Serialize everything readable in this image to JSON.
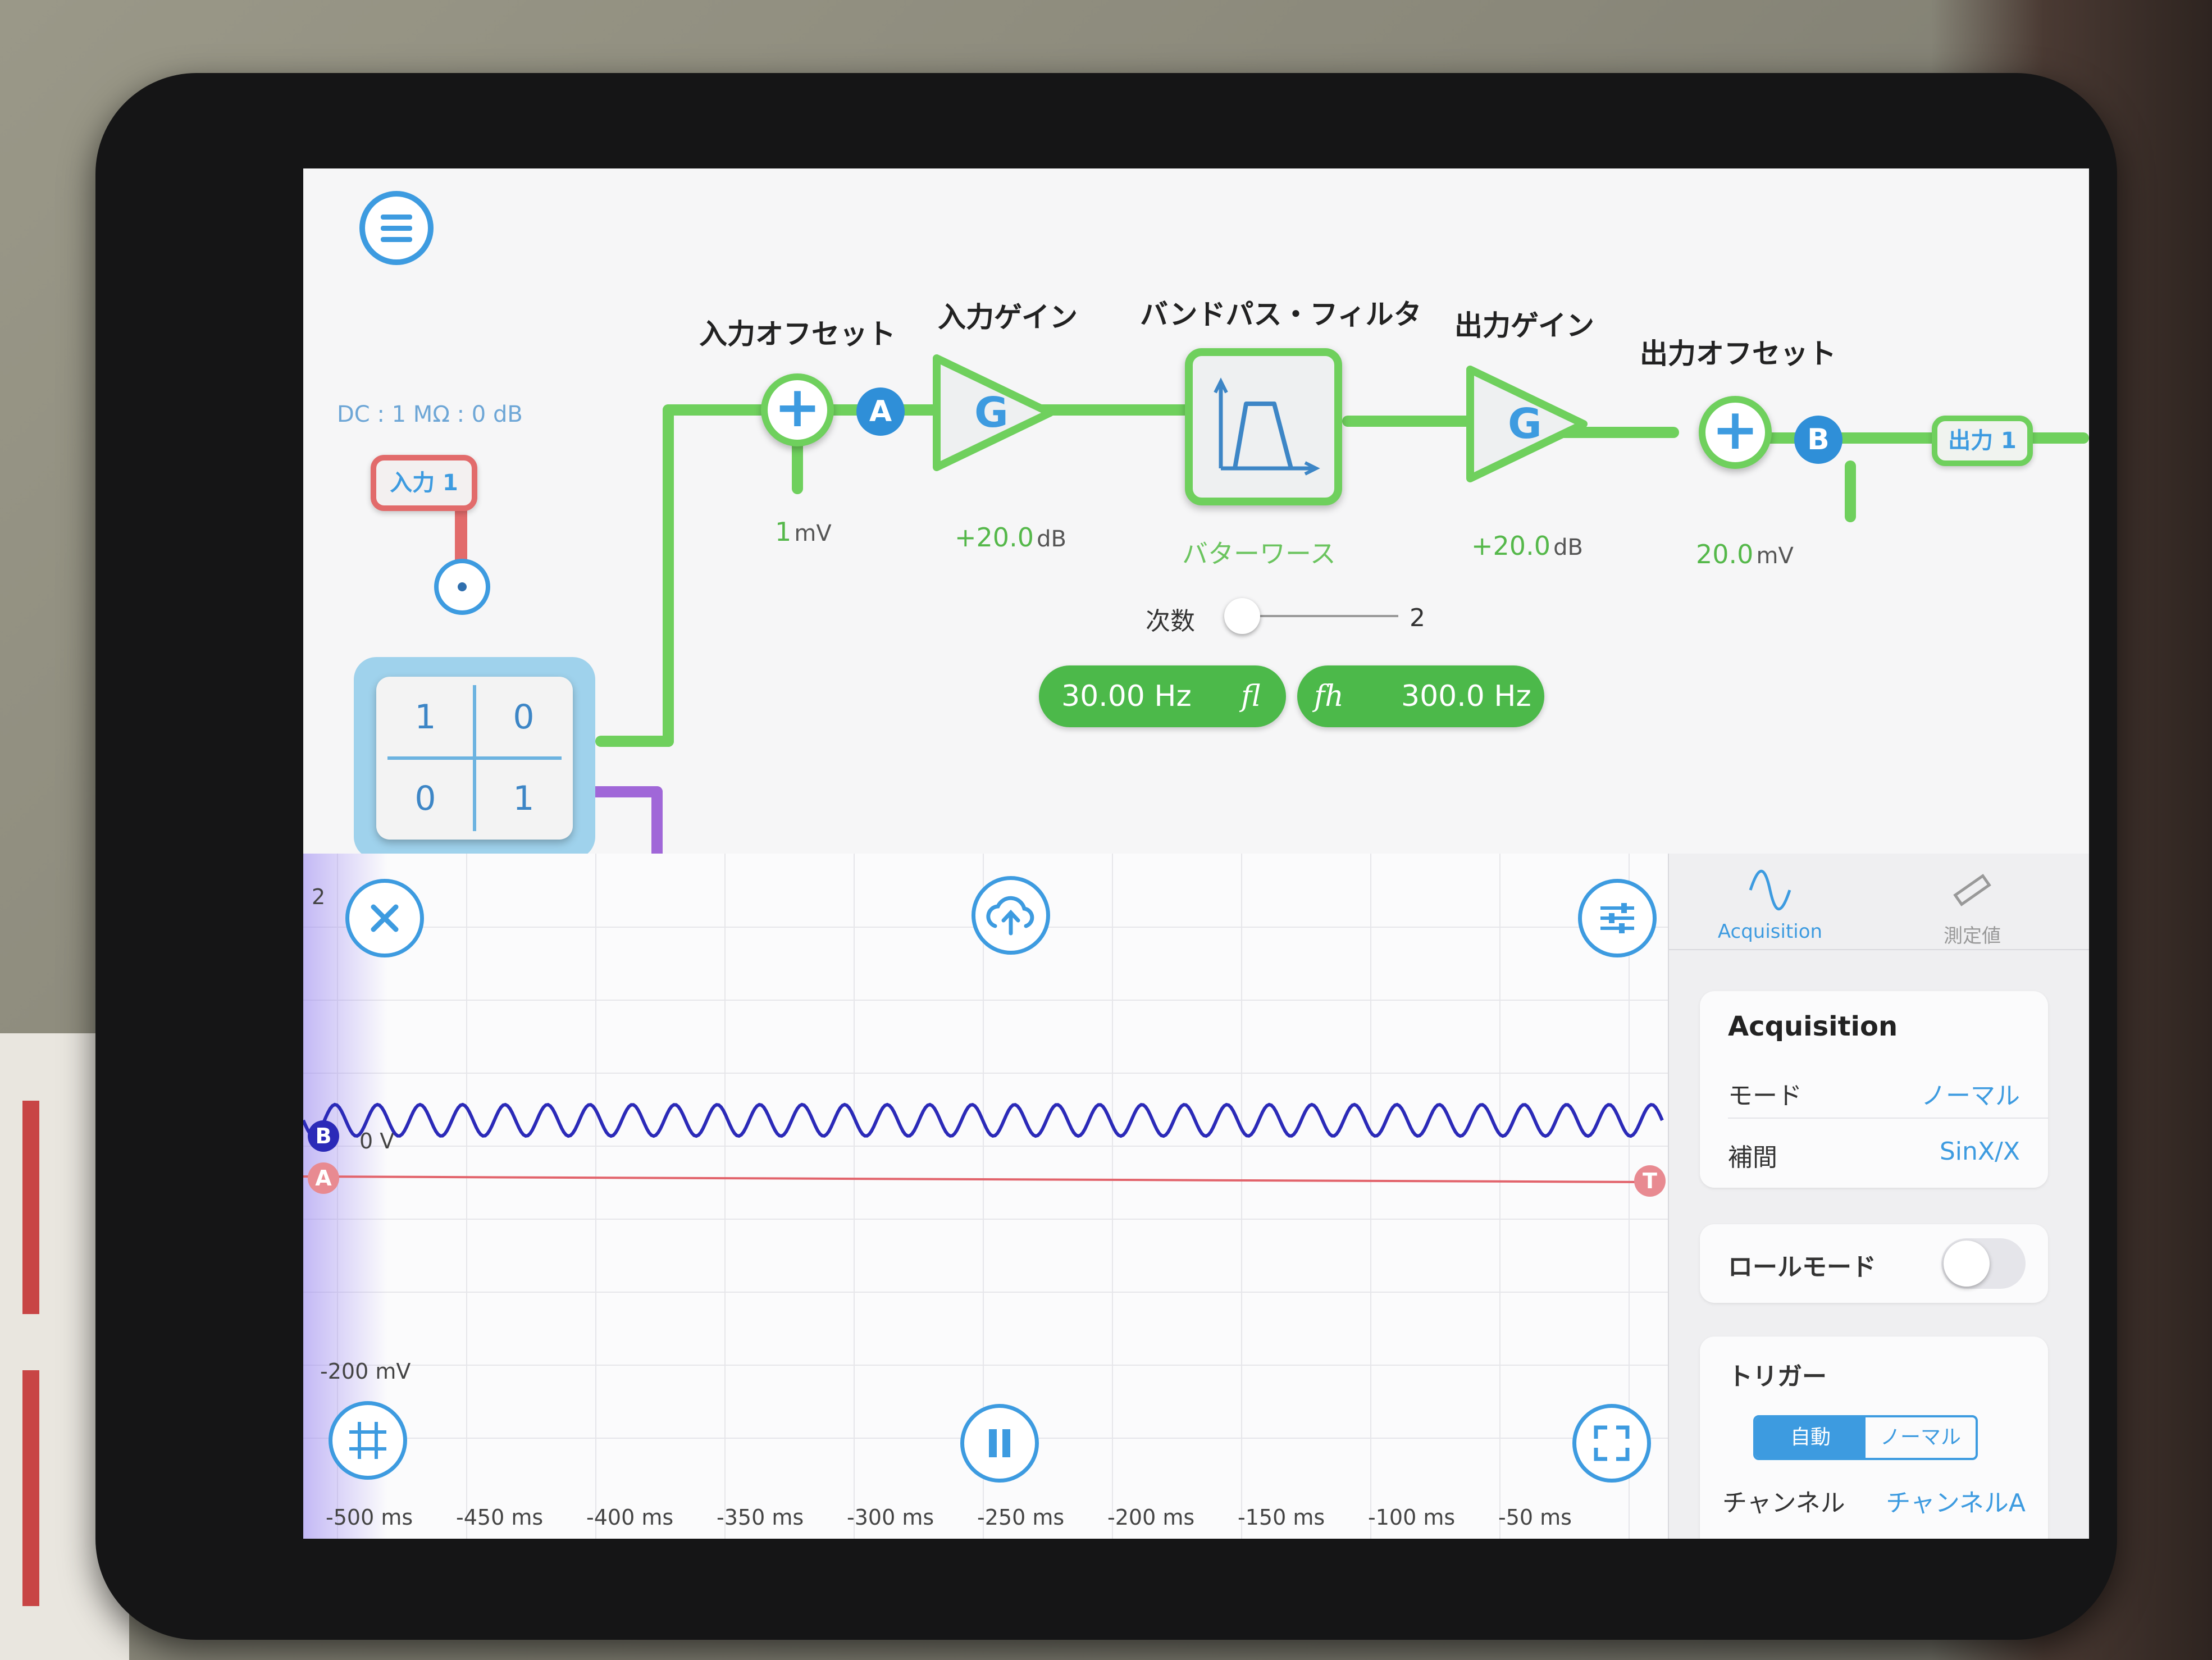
{
  "pipeline": {
    "input_label": "入力 1",
    "input_coupling": "DC : 1 MΩ : 0 dB",
    "matrix": [
      "1",
      "0",
      "0",
      "1"
    ],
    "input_offset": {
      "title": "入力オフセット",
      "value": "1",
      "unit": "mV"
    },
    "probe_a": "A",
    "input_gain": {
      "title": "入力ゲイン",
      "symbol": "G",
      "value": "+20.0",
      "unit": "dB"
    },
    "bandpass": {
      "title": "バンドパス・フィルタ",
      "type": "バターワース",
      "order_label": "次数",
      "order_value": "2"
    },
    "output_gain": {
      "title": "出力ゲイン",
      "symbol": "G",
      "value": "+20.0",
      "unit": "dB"
    },
    "output_offset": {
      "title": "出力オフセット",
      "value": "20.0",
      "unit": "mV"
    },
    "probe_b": "B",
    "output_label": "出力 1",
    "f_low": {
      "value": "30.00 Hz",
      "symbol": "fl"
    },
    "f_high": {
      "value": "300.0 Hz",
      "symbol": "fh"
    }
  },
  "scope": {
    "top_label": "2",
    "zero_label": "0 V",
    "bottom_label": "-200 mV",
    "channel_b": "B",
    "channel_a": "A",
    "trigger_marker": "T",
    "x_ticks": [
      "-500 ms",
      "-450 ms",
      "-400 ms",
      "-350 ms",
      "-300 ms",
      "-250 ms",
      "-200 ms",
      "-150 ms",
      "-100 ms",
      "-50 ms"
    ]
  },
  "side_panel": {
    "tabs": [
      "Acquisition",
      "測定値"
    ],
    "acquisition_title": "Acquisition",
    "mode_label": "モード",
    "mode_value": "ノーマル",
    "interp_label": "補間",
    "interp_value": "SinX/X",
    "roll_mode_label": "ロールモード",
    "roll_mode_on": false,
    "trigger_title": "トリガー",
    "trigger_options": [
      "自動",
      "ノーマル"
    ],
    "trigger_selected": "自動",
    "channel_label": "チャンネル",
    "channel_value": "チャンネルA"
  },
  "colors": {
    "accent": "#3d9be0",
    "wire_green": "#6fd05d",
    "wire_red": "#e26b6b",
    "trace_b": "#2b2ab8",
    "trace_a": "#e2636b",
    "chip_green": "#4cb94a"
  },
  "icons": [
    "menu-icon",
    "close-icon",
    "cloud-upload-icon",
    "sliders-icon",
    "grid-icon",
    "pause-icon",
    "expand-icon",
    "sine-wave-icon",
    "ruler-icon"
  ]
}
